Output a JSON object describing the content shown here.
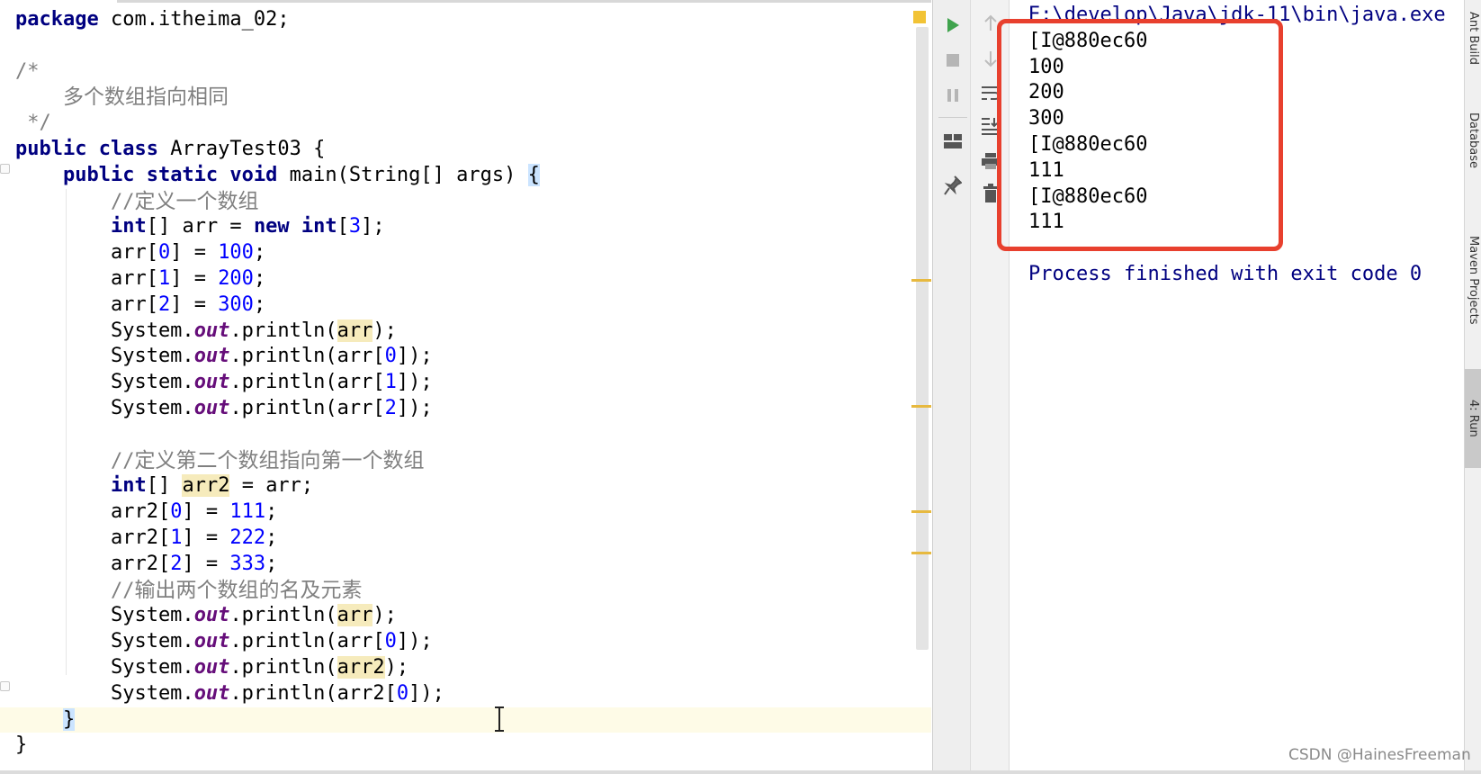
{
  "editor": {
    "lines": [
      {
        "parts": [
          {
            "t": "package",
            "c": "kw"
          },
          {
            "t": " com.itheima_02;"
          }
        ]
      },
      {
        "parts": []
      },
      {
        "parts": [
          {
            "t": "/*",
            "c": "cm"
          }
        ]
      },
      {
        "parts": [
          {
            "t": "    ",
            "c": "cm"
          },
          {
            "t": "多个数组指向相同",
            "c": "cm-zh"
          }
        ]
      },
      {
        "parts": [
          {
            "t": " */",
            "c": "cm"
          }
        ]
      },
      {
        "parts": [
          {
            "t": "public class",
            "c": "kw"
          },
          {
            "t": " ArrayTest03 {"
          }
        ]
      },
      {
        "parts": [
          {
            "t": "    "
          },
          {
            "t": "public static void",
            "c": "kw"
          },
          {
            "t": " main(String[] args) "
          },
          {
            "t": "{",
            "c": "brace-hl"
          }
        ]
      },
      {
        "parts": [
          {
            "t": "        //",
            "c": "cm"
          },
          {
            "t": "定义一个数组",
            "c": "cm-zh"
          }
        ]
      },
      {
        "parts": [
          {
            "t": "        "
          },
          {
            "t": "int",
            "c": "kw"
          },
          {
            "t": "[] arr = "
          },
          {
            "t": "new int",
            "c": "kw"
          },
          {
            "t": "["
          },
          {
            "t": "3",
            "c": "num"
          },
          {
            "t": "];"
          }
        ]
      },
      {
        "parts": [
          {
            "t": "        arr["
          },
          {
            "t": "0",
            "c": "num"
          },
          {
            "t": "] = "
          },
          {
            "t": "100",
            "c": "num"
          },
          {
            "t": ";"
          }
        ]
      },
      {
        "parts": [
          {
            "t": "        arr["
          },
          {
            "t": "1",
            "c": "num"
          },
          {
            "t": "] = "
          },
          {
            "t": "200",
            "c": "num"
          },
          {
            "t": ";"
          }
        ]
      },
      {
        "parts": [
          {
            "t": "        arr["
          },
          {
            "t": "2",
            "c": "num"
          },
          {
            "t": "] = "
          },
          {
            "t": "300",
            "c": "num"
          },
          {
            "t": ";"
          }
        ]
      },
      {
        "parts": [
          {
            "t": "        System."
          },
          {
            "t": "out",
            "c": "fld"
          },
          {
            "t": ".println("
          },
          {
            "t": "arr",
            "c": "hl"
          },
          {
            "t": ");"
          }
        ]
      },
      {
        "parts": [
          {
            "t": "        System."
          },
          {
            "t": "out",
            "c": "fld"
          },
          {
            "t": ".println(arr["
          },
          {
            "t": "0",
            "c": "num"
          },
          {
            "t": "]);"
          }
        ]
      },
      {
        "parts": [
          {
            "t": "        System."
          },
          {
            "t": "out",
            "c": "fld"
          },
          {
            "t": ".println(arr["
          },
          {
            "t": "1",
            "c": "num"
          },
          {
            "t": "]);"
          }
        ]
      },
      {
        "parts": [
          {
            "t": "        System."
          },
          {
            "t": "out",
            "c": "fld"
          },
          {
            "t": ".println(arr["
          },
          {
            "t": "2",
            "c": "num"
          },
          {
            "t": "]);"
          }
        ]
      },
      {
        "parts": []
      },
      {
        "parts": [
          {
            "t": "        //",
            "c": "cm"
          },
          {
            "t": "定义第二个数组指向第一个数组",
            "c": "cm-zh"
          }
        ]
      },
      {
        "parts": [
          {
            "t": "        "
          },
          {
            "t": "int",
            "c": "kw"
          },
          {
            "t": "[] "
          },
          {
            "t": "arr2",
            "c": "hl"
          },
          {
            "t": " = arr;"
          }
        ]
      },
      {
        "parts": [
          {
            "t": "        arr2["
          },
          {
            "t": "0",
            "c": "num"
          },
          {
            "t": "] = "
          },
          {
            "t": "111",
            "c": "num"
          },
          {
            "t": ";"
          }
        ]
      },
      {
        "parts": [
          {
            "t": "        arr2["
          },
          {
            "t": "1",
            "c": "num"
          },
          {
            "t": "] = "
          },
          {
            "t": "222",
            "c": "num"
          },
          {
            "t": ";"
          }
        ]
      },
      {
        "parts": [
          {
            "t": "        arr2["
          },
          {
            "t": "2",
            "c": "num"
          },
          {
            "t": "] = "
          },
          {
            "t": "333",
            "c": "num"
          },
          {
            "t": ";"
          }
        ]
      },
      {
        "parts": [
          {
            "t": "        //",
            "c": "cm"
          },
          {
            "t": "输出两个数组的名及元素",
            "c": "cm-zh"
          }
        ]
      },
      {
        "parts": [
          {
            "t": "        System."
          },
          {
            "t": "out",
            "c": "fld"
          },
          {
            "t": ".println("
          },
          {
            "t": "arr",
            "c": "hl"
          },
          {
            "t": ");"
          }
        ]
      },
      {
        "parts": [
          {
            "t": "        System."
          },
          {
            "t": "out",
            "c": "fld"
          },
          {
            "t": ".println(arr["
          },
          {
            "t": "0",
            "c": "num"
          },
          {
            "t": "]);"
          }
        ]
      },
      {
        "parts": [
          {
            "t": "        System."
          },
          {
            "t": "out",
            "c": "fld"
          },
          {
            "t": ".println("
          },
          {
            "t": "arr2",
            "c": "hl"
          },
          {
            "t": ");"
          }
        ]
      },
      {
        "parts": [
          {
            "t": "        System."
          },
          {
            "t": "out",
            "c": "fld"
          },
          {
            "t": ".println(arr2["
          },
          {
            "t": "0",
            "c": "num"
          },
          {
            "t": "]);"
          }
        ]
      },
      {
        "parts": [
          {
            "t": "    "
          },
          {
            "t": "}",
            "c": "brace-hl"
          }
        ],
        "current": true
      },
      {
        "parts": [
          {
            "t": "}"
          }
        ]
      }
    ]
  },
  "console": {
    "command": "E:\\develop\\Java\\jdk-11\\bin\\java.exe",
    "output": [
      "[I@880ec60",
      "100",
      "200",
      "300",
      "[I@880ec60",
      "111",
      "[I@880ec60",
      "111"
    ],
    "exit_message": "Process finished with exit code 0"
  },
  "side_tabs": {
    "ant_build": "Ant Build",
    "database": "Database",
    "maven_projects": "Maven Projects",
    "run": "4: Run"
  },
  "watermark": "CSDN @HainesFreeman",
  "colors": {
    "keyword": "#000080",
    "number": "#0000ff",
    "comment": "#808080",
    "field": "#660e7a",
    "highlight_box": "#e8402e",
    "run_green": "#3fa34d"
  },
  "icons": {
    "run_toolbar_left": [
      "run-icon",
      "stop-icon",
      "pause-icon",
      "layout-icon",
      "pin-icon"
    ],
    "run_toolbar_right": [
      "up-arrow-icon",
      "down-arrow-icon",
      "soft-wrap-icon",
      "scroll-to-end-icon",
      "print-icon",
      "trash-icon"
    ]
  }
}
